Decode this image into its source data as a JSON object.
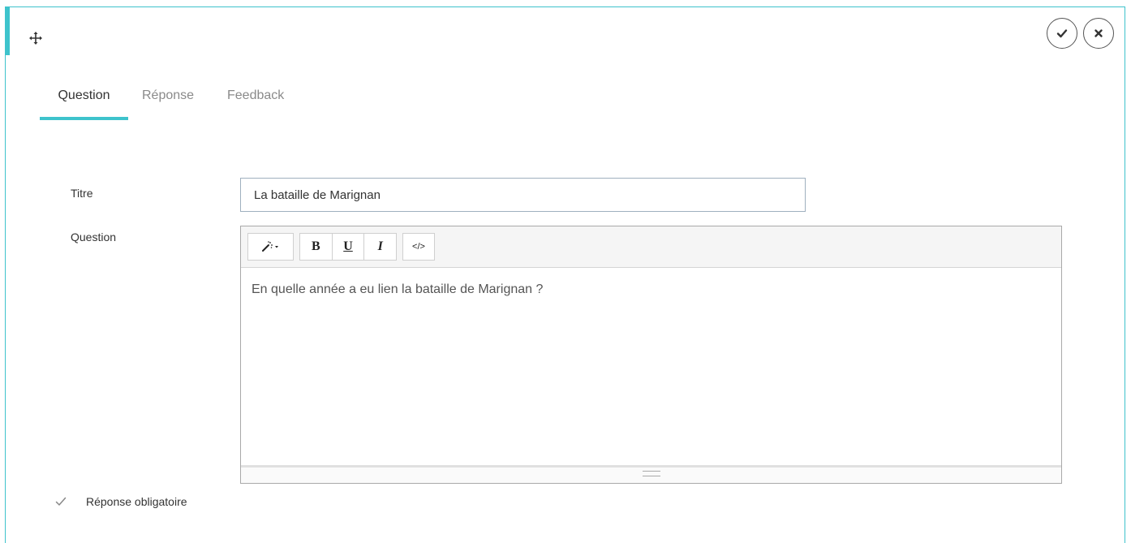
{
  "header": {
    "move_icon": "move-icon",
    "validate_icon": "check-icon",
    "close_icon": "close-icon"
  },
  "tabs": [
    {
      "label": "Question",
      "active": true
    },
    {
      "label": "Réponse",
      "active": false
    },
    {
      "label": "Feedback",
      "active": false
    }
  ],
  "form": {
    "title_label": "Titre",
    "title_value": "La bataille de Marignan",
    "question_label": "Question",
    "question_text": "En quelle année a eu lien la bataille de Marignan ?"
  },
  "toolbar": {
    "style_icon": "magic-wand-icon",
    "bold_label": "B",
    "underline_label": "U",
    "italic_label": "I",
    "code_label": "</>"
  },
  "required": {
    "label": "Réponse obligatoire",
    "checked": true
  },
  "colors": {
    "accent": "#3ec3cc"
  }
}
